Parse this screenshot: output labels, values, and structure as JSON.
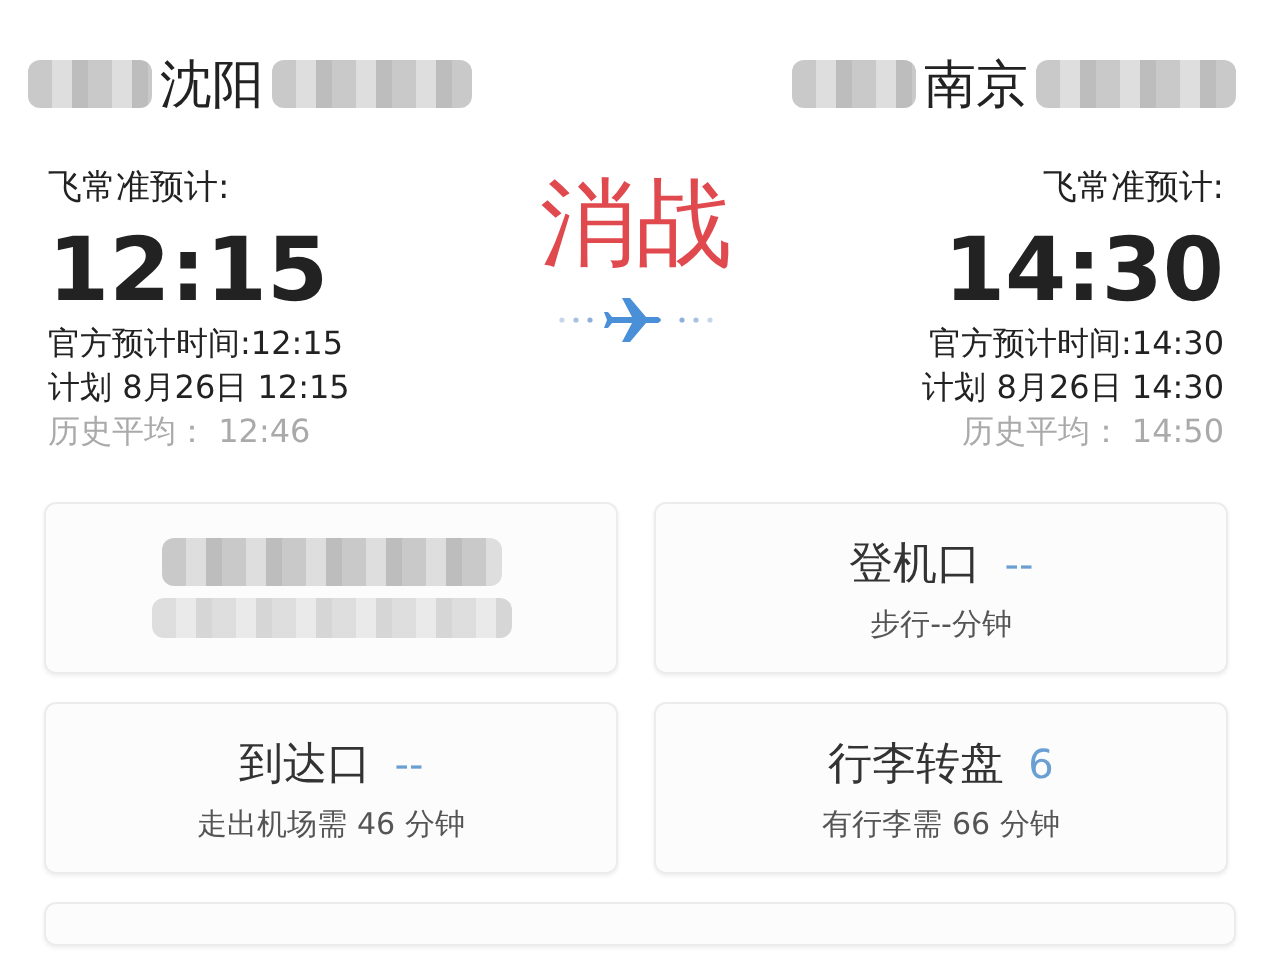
{
  "departure": {
    "city": "沈阳",
    "label": "飞常准预计:",
    "time": "12:15",
    "official": "官方预计时间:12:15",
    "scheduled": "计划 8月26日 12:15",
    "average": "历史平均： 12:46"
  },
  "status": "消战",
  "arrival": {
    "city": "南京",
    "label": "飞常准预计:",
    "time": "14:30",
    "official": "官方预计时间:14:30",
    "scheduled": "计划 8月26日 14:30",
    "average": "历史平均： 14:50"
  },
  "cards": [
    {
      "kind": "hidden"
    },
    {
      "kind": "info",
      "title": "登机口",
      "value": "--",
      "note": "步行--分钟"
    },
    {
      "kind": "info",
      "title": "到达口",
      "value": "--",
      "note": "走出机场需 46 分钟"
    },
    {
      "kind": "info",
      "title": "行李转盘",
      "value": "6",
      "note": "有行李需 66 分钟"
    }
  ]
}
